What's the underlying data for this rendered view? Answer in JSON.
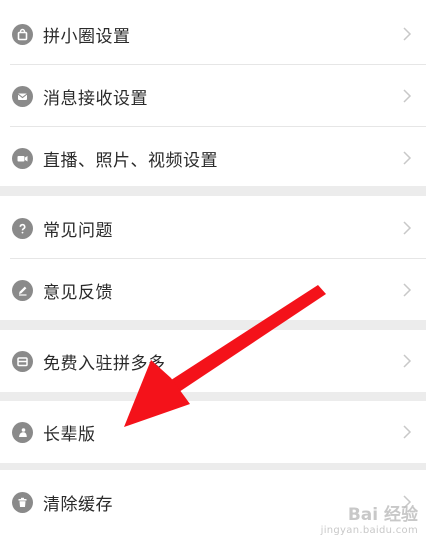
{
  "groups": [
    {
      "items": [
        {
          "label": "拼小圈设置",
          "icon": "bag-icon"
        },
        {
          "label": "消息接收设置",
          "icon": "message-icon"
        },
        {
          "label": "直播、照片、视频设置",
          "icon": "camera-icon"
        }
      ]
    },
    {
      "items": [
        {
          "label": "常见问题",
          "icon": "question-icon"
        },
        {
          "label": "意见反馈",
          "icon": "pencil-icon"
        }
      ]
    },
    {
      "items": [
        {
          "label": "免费入驻拼多多",
          "icon": "store-icon"
        }
      ]
    },
    {
      "items": [
        {
          "label": "长辈版",
          "icon": "elder-icon"
        }
      ]
    },
    {
      "items": [
        {
          "label": "清除缓存",
          "icon": "trash-icon"
        }
      ]
    }
  ],
  "watermark": {
    "main": "Bai 经验",
    "sub": "jingyan.baidu.com"
  },
  "annotation": {
    "color": "#f4121a"
  }
}
